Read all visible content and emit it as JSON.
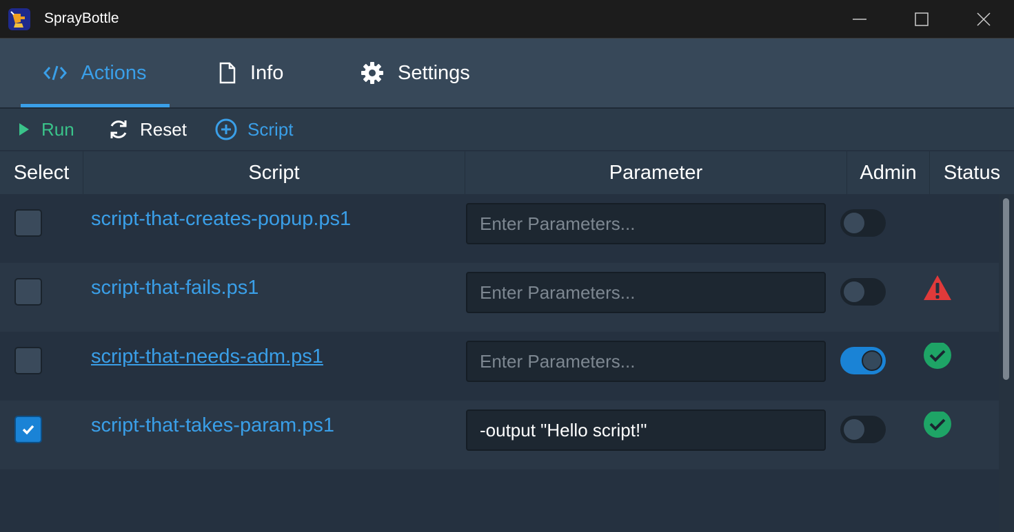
{
  "window": {
    "title": "SprayBottle",
    "icon": "spray-bottle-app-icon",
    "controls": [
      "minimize-icon",
      "maximize-icon",
      "close-icon"
    ]
  },
  "tabs": [
    {
      "label": "Actions",
      "icon": "code-icon",
      "active": true
    },
    {
      "label": "Info",
      "icon": "document-icon",
      "active": false
    },
    {
      "label": "Settings",
      "icon": "gear-icon",
      "active": false
    }
  ],
  "toolbar": {
    "run_label": "Run",
    "reset_label": "Reset",
    "script_label": "Script"
  },
  "table": {
    "headers": {
      "select": "Select",
      "script": "Script",
      "parameter": "Parameter",
      "admin": "Admin",
      "status": "Status"
    },
    "rows": [
      {
        "selected": false,
        "script": "script-that-creates-popup.ps1",
        "parameter": "",
        "placeholder": "Enter Parameters...",
        "admin": false,
        "status": "none"
      },
      {
        "selected": false,
        "script": "script-that-fails.ps1",
        "parameter": "",
        "placeholder": "Enter Parameters...",
        "admin": false,
        "status": "error"
      },
      {
        "selected": false,
        "script": "script-that-needs-adm.ps1",
        "parameter": "",
        "placeholder": "Enter Parameters...",
        "admin": true,
        "status": "success"
      },
      {
        "selected": true,
        "script": "script-that-takes-param.ps1",
        "parameter": "-output \"Hello script!\"",
        "placeholder": "Enter Parameters...",
        "admin": false,
        "status": "success"
      }
    ]
  },
  "colors": {
    "accent": "#3a9fe8",
    "run": "#3ac38a",
    "success": "#1ea466",
    "error": "#e03a3a"
  }
}
